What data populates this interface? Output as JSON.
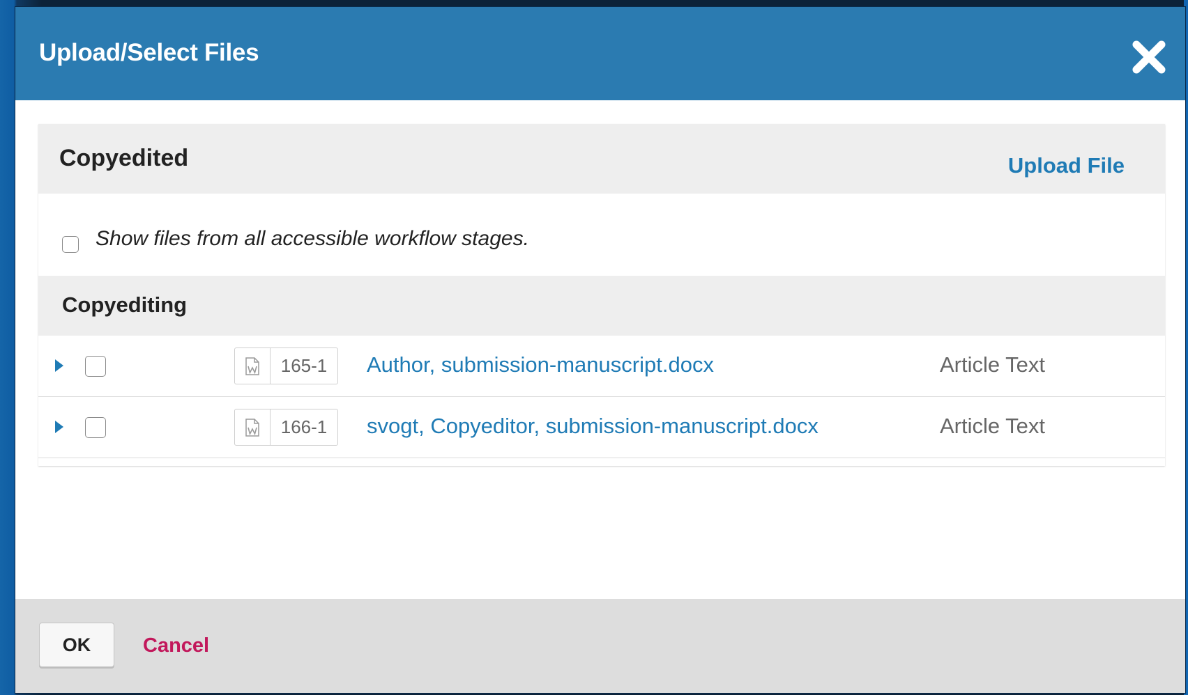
{
  "modal": {
    "title": "Upload/Select Files",
    "close_icon": "close-icon"
  },
  "panel": {
    "title": "Copyedited",
    "upload_label": "Upload File",
    "filter": {
      "label": "Show files from all accessible workflow stages.",
      "checked": false
    },
    "stage": {
      "title": "Copyediting"
    },
    "files": [
      {
        "id": "165-1",
        "name": "Author, submission-manuscript.docx",
        "genre": "Article Text",
        "icon": "word-document-icon",
        "checked": false
      },
      {
        "id": "166-1",
        "name": "svogt, Copyeditor, submission-manuscript.docx",
        "genre": "Article Text",
        "icon": "word-document-icon",
        "checked": false
      }
    ]
  },
  "footer": {
    "ok_label": "OK",
    "cancel_label": "Cancel"
  },
  "colors": {
    "header_bg": "#2b7bb1",
    "link": "#1f7bb5",
    "cancel": "#c2185b",
    "panel_header_bg": "#eeeeee",
    "footer_bg": "#dddddd"
  }
}
